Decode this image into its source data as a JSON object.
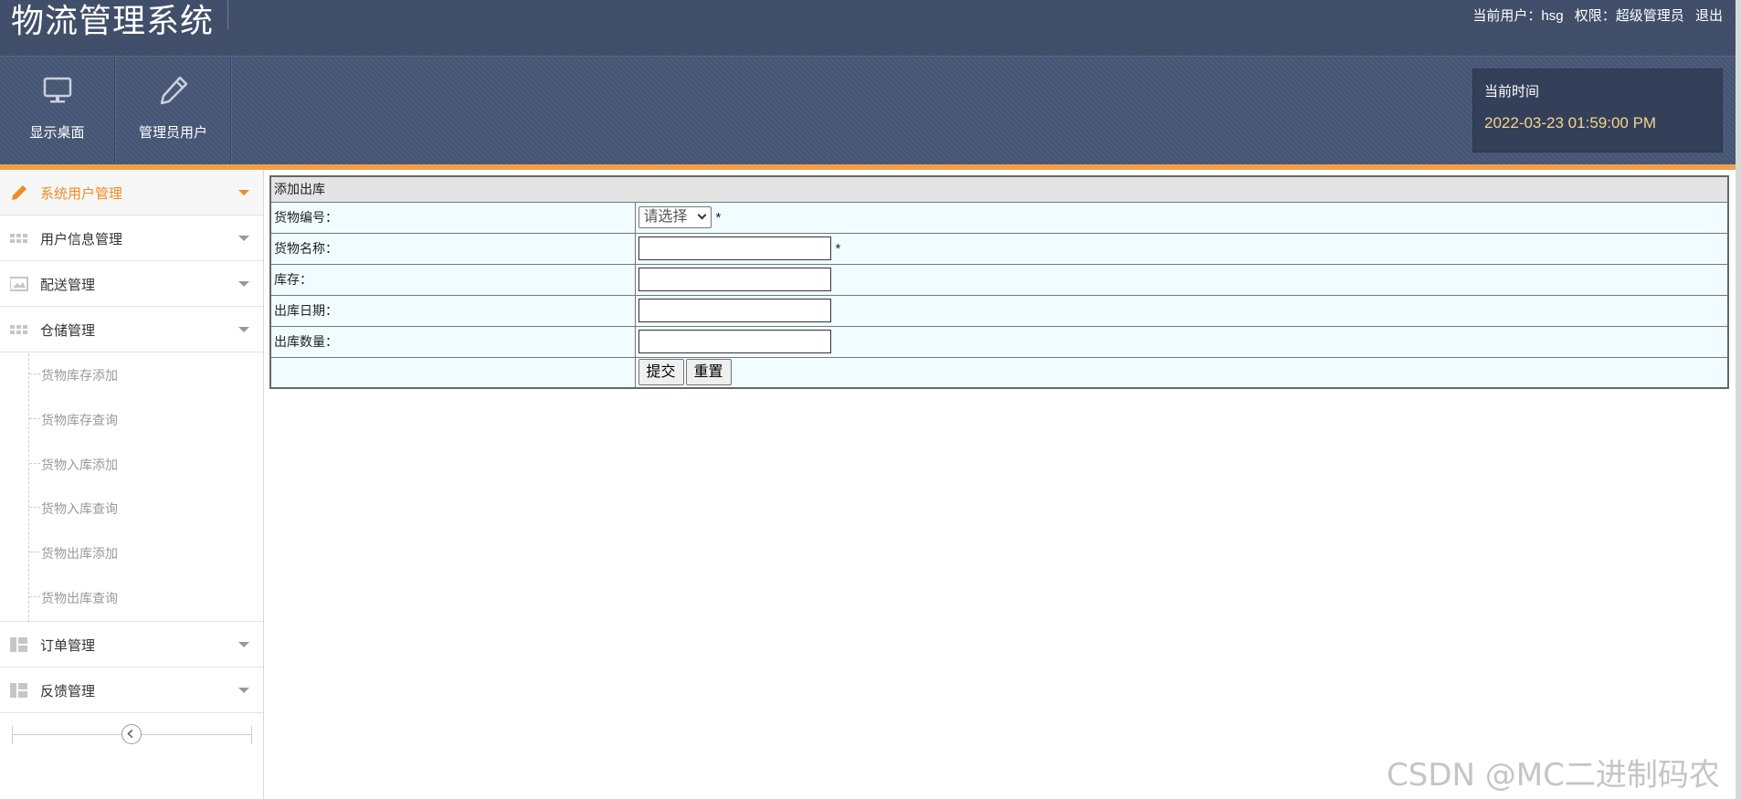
{
  "header": {
    "app_title": "物流管理系统",
    "user_prefix": "当前用户：",
    "username": "hsg",
    "role_prefix": "权限：",
    "role": "超级管理员",
    "logout": "退出"
  },
  "toolbar": {
    "buttons": [
      {
        "label": "显示桌面",
        "icon": "monitor-icon"
      },
      {
        "label": "管理员用户",
        "icon": "pencil-icon"
      }
    ],
    "time_label": "当前时间",
    "time_value": "2022-03-23 01:59:00 PM"
  },
  "sidebar": {
    "menus": [
      {
        "label": "系统用户管理",
        "icon": "pencil-icon",
        "active": true
      },
      {
        "label": "用户信息管理",
        "icon": "grid-icon"
      },
      {
        "label": "配送管理",
        "icon": "picture-icon"
      },
      {
        "label": "仓储管理",
        "icon": "grid-icon",
        "expanded": true
      },
      {
        "label": "订单管理",
        "icon": "layout-icon"
      },
      {
        "label": "反馈管理",
        "icon": "layout-icon"
      }
    ],
    "warehouse_submenu": [
      "货物库存添加",
      "货物库存查询",
      "货物入库添加",
      "货物入库查询",
      "货物出库添加",
      "货物出库查询"
    ],
    "collapse_icon": "chevron-left-icon"
  },
  "form": {
    "caption": "添加出库",
    "fields": {
      "goods_no": {
        "label": "货物编号：",
        "value": "请选择",
        "required": "*"
      },
      "goods_name": {
        "label": "货物名称：",
        "value": "",
        "required": "*"
      },
      "stock": {
        "label": "库存：",
        "value": ""
      },
      "out_date": {
        "label": "出库日期：",
        "value": ""
      },
      "out_qty": {
        "label": "出库数量：",
        "value": ""
      }
    },
    "submit_label": "提交",
    "reset_label": "重置"
  },
  "watermark": "CSDN @MC二进制码农",
  "colors": {
    "header_bg": "#3f4d69",
    "toolbar_bg": "#475776",
    "accent_orange": "#f0a04a",
    "time_text": "#f4d58a",
    "form_bg": "#f0fcff"
  }
}
